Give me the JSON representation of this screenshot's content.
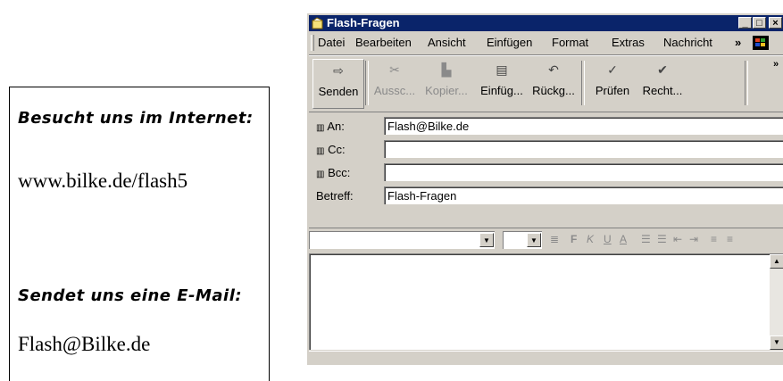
{
  "info": {
    "heading_web": "Besucht uns im Internet:",
    "url": "www.bilke.de/flash5",
    "heading_mail": "Sendet uns eine E-Mail:",
    "email": "Flash@Bilke.de"
  },
  "window": {
    "title": "Flash-Fragen",
    "minimize": "_",
    "maximize": "□",
    "close": "×"
  },
  "menu": [
    "Datei",
    "Bearbeiten",
    "Ansicht",
    "Einfügen",
    "Format",
    "Extras",
    "Nachricht",
    "»"
  ],
  "toolbar": {
    "send": "Senden",
    "cut": "Aussc...",
    "copy": "Kopier...",
    "paste": "Einfüg...",
    "undo": "Rückg...",
    "check": "Prüfen",
    "spell": "Recht...",
    "more": "»"
  },
  "header": {
    "to_label": "An:",
    "to_value": "Flash@Bilke.de",
    "cc_label": "Cc:",
    "cc_value": "",
    "bcc_label": "Bcc:",
    "bcc_value": "",
    "subject_label": "Betreff:",
    "subject_value": "Flash-Fragen"
  },
  "format_bar": {
    "bold": "F",
    "italic": "K",
    "underline": "U",
    "color": "A"
  },
  "icons": [
    "outlook-icon",
    "send-icon",
    "cut-icon",
    "copy-icon",
    "paste-icon",
    "undo-icon",
    "check-names-icon",
    "spellcheck-icon",
    "address-book-icon",
    "windows-logo-icon"
  ],
  "colors": {
    "titlebar": "#0a246a",
    "window_face": "#d4d0c8"
  }
}
